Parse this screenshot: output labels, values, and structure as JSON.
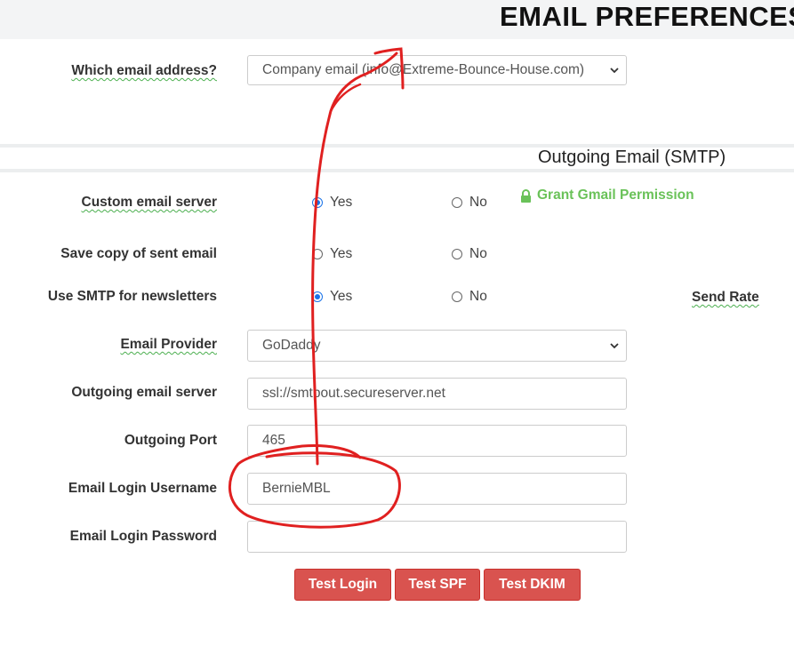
{
  "header": {
    "title": "EMAIL PREFERENCES"
  },
  "email_address": {
    "label": "Which email address?",
    "value": "Company email (info@Extreme-Bounce-House.com)"
  },
  "smtp_section": {
    "title": "Outgoing Email (SMTP)"
  },
  "custom_server": {
    "label": "Custom email server",
    "yes": "Yes",
    "no": "No",
    "selected": "Yes"
  },
  "grant_gmail": {
    "label": "Grant Gmail Permission",
    "icon": "lock-icon",
    "color": "#6ac259"
  },
  "save_copy": {
    "label": "Save copy of sent email",
    "yes": "Yes",
    "no": "No",
    "selected": ""
  },
  "smtp_newsletters": {
    "label": "Use SMTP for newsletters",
    "yes": "Yes",
    "no": "No",
    "selected": "Yes"
  },
  "send_rate": {
    "label": "Send Rate"
  },
  "provider": {
    "label": "Email Provider",
    "value": "GoDaddy"
  },
  "server": {
    "label": "Outgoing email server",
    "value": "ssl://smtpout.secureserver.net"
  },
  "port": {
    "label": "Outgoing Port",
    "value": "465"
  },
  "username": {
    "label": "Email Login Username",
    "value": "BernieMBL"
  },
  "password": {
    "label": "Email Login Password",
    "value": ""
  },
  "buttons": {
    "test_login": "Test Login",
    "test_spf": "Test SPF",
    "test_dkim": "Test DKIM",
    "color": "#d9534f"
  },
  "annotation": {
    "color": "#e02020"
  }
}
